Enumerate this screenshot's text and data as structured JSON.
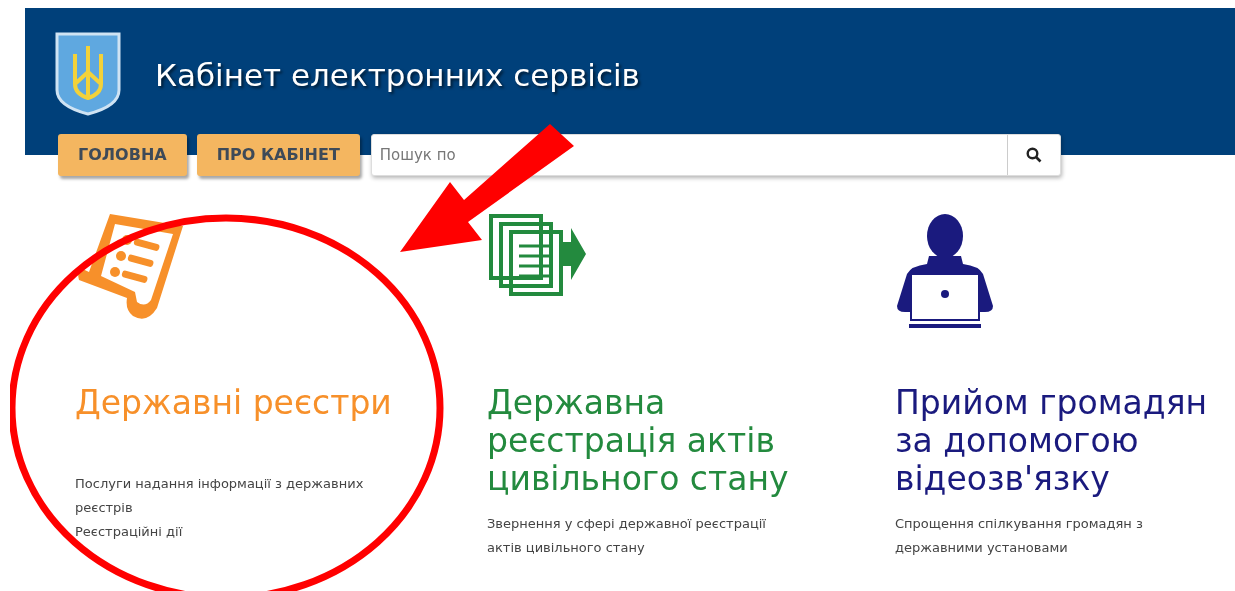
{
  "header": {
    "title": "Кабінет електронних сервісів"
  },
  "nav": [
    {
      "label": "ГОЛОВНА"
    },
    {
      "label": "ПРО КАБІНЕТ"
    }
  ],
  "search": {
    "placeholder": "Пошук по"
  },
  "services": [
    {
      "kind": "registers",
      "title": "Державні реєстри",
      "lines": [
        "Послуги надання інформації з державних реєстрів",
        "Реєстраційні дії"
      ],
      "color": "#f7902a"
    },
    {
      "kind": "civil",
      "title": "Державна реєстрація актів цивільного стану",
      "lines": [
        "Звернення у сфері державної реєстрації актів цивільного стану"
      ],
      "color": "#238a3e"
    },
    {
      "kind": "video",
      "title": "Прийом громадян за допомогою відеозв'язку",
      "lines": [
        "Спрощення спілкування громадян з державними установами"
      ],
      "color": "#1a1a7e"
    }
  ]
}
